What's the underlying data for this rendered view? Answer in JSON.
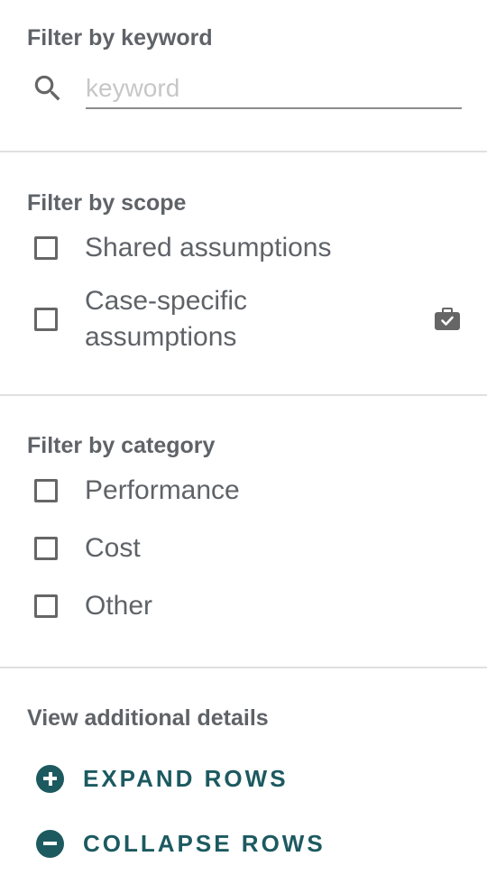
{
  "keyword": {
    "title": "Filter by keyword",
    "input_value": "",
    "placeholder": "keyword",
    "icon": "search-icon"
  },
  "scope": {
    "title": "Filter by scope",
    "options": [
      {
        "label": "Shared assumptions",
        "checked": false
      },
      {
        "label": "Case-specific assumptions",
        "checked": false,
        "icon": "briefcase-check-icon"
      }
    ]
  },
  "category": {
    "title": "Filter by category",
    "options": [
      {
        "label": "Performance",
        "checked": false
      },
      {
        "label": "Cost",
        "checked": false
      },
      {
        "label": "Other",
        "checked": false
      }
    ]
  },
  "details": {
    "title": "View additional details",
    "expand_label": "EXPAND ROWS",
    "collapse_label": "COLLAPSE ROWS",
    "expand_icon": "plus-circle-icon",
    "collapse_icon": "minus-circle-icon"
  },
  "colors": {
    "accent": "#1c5a60",
    "text": "#5f6368",
    "divider": "#e0e0e0",
    "placeholder": "#c7c7c7"
  }
}
